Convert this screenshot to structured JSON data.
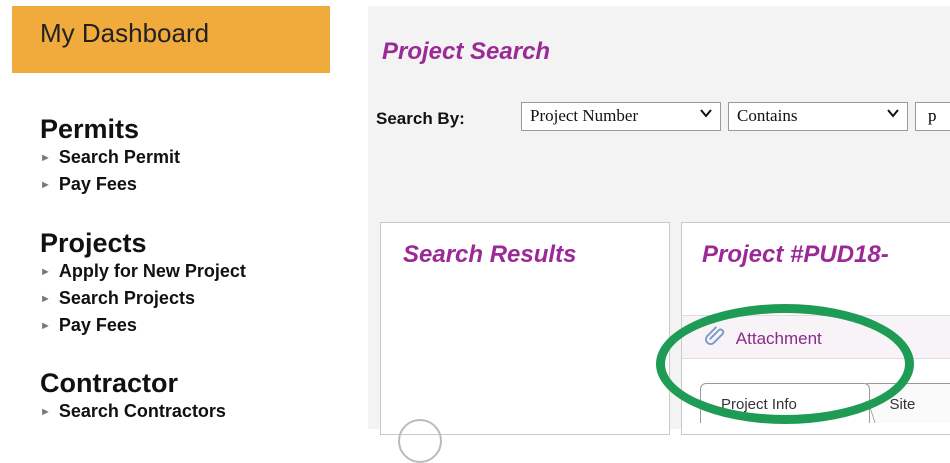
{
  "sidebar": {
    "dashboard_label": "My Dashboard",
    "sections": [
      {
        "title": "Permits",
        "items": [
          "Search Permit",
          "Pay Fees"
        ]
      },
      {
        "title": "Projects",
        "items": [
          "Apply for New Project",
          "Search Projects",
          "Pay Fees"
        ]
      },
      {
        "title": "Contractor",
        "items": [
          "Search Contractors"
        ]
      }
    ]
  },
  "search": {
    "title": "Project Search",
    "by_label": "Search By:",
    "field_select": "Project Number",
    "operator_select": "Contains",
    "input_value": "p"
  },
  "results": {
    "title": "Search Results"
  },
  "detail": {
    "title": "Project #PUD18-",
    "attachment_label": "Attachment",
    "tabs": [
      "Project Info",
      "Site"
    ]
  },
  "colors": {
    "dashboard_bg": "#f1aa3c",
    "accent_purple": "#9b2a96",
    "highlight_green": "#1e9b54",
    "main_bg": "#f3f3f3"
  },
  "icons": [
    "paperclip-icon",
    "chevron-down-icon",
    "triangle-bullet-icon"
  ]
}
